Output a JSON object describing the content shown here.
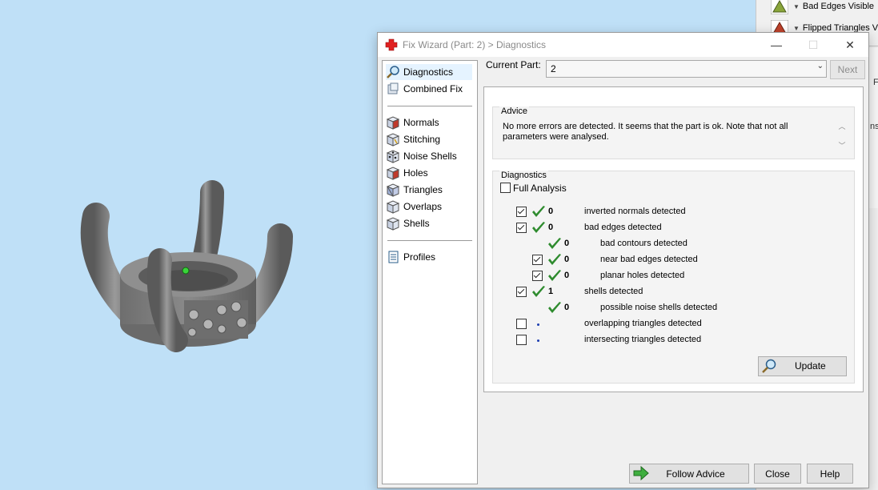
{
  "background_panel": {
    "items": [
      {
        "label": "Bad Edges Visible",
        "icon": "triangle-icon",
        "color": "#8aa53a"
      },
      {
        "label": "Flipped Triangles V",
        "icon": "triangle-icon",
        "color": "#c0432c"
      }
    ],
    "fragments": [
      "ns",
      "F"
    ]
  },
  "dialog": {
    "title": "Fix Wizard (Part: 2) > Diagnostics",
    "app_icon": "red-cross-icon",
    "window_buttons": {
      "minimize": "—",
      "maximize": "☐",
      "close": "✕"
    },
    "nav": {
      "items_top": [
        {
          "label": "Diagnostics",
          "icon": "magnifier-icon",
          "selected": true
        },
        {
          "label": "Combined Fix",
          "icon": "combined-fix-icon",
          "selected": false
        }
      ],
      "items_mid": [
        {
          "label": "Normals",
          "icon": "normals-cube-icon"
        },
        {
          "label": "Stitching",
          "icon": "stitching-cube-icon"
        },
        {
          "label": "Noise Shells",
          "icon": "noise-shells-cube-icon"
        },
        {
          "label": "Holes",
          "icon": "holes-cube-icon"
        },
        {
          "label": "Triangles",
          "icon": "triangles-cube-icon"
        },
        {
          "label": "Overlaps",
          "icon": "overlaps-cube-icon"
        },
        {
          "label": "Shells",
          "icon": "shells-cube-icon"
        }
      ],
      "items_bottom": [
        {
          "label": "Profiles",
          "icon": "document-icon"
        }
      ]
    },
    "current_part_label": "Current Part:",
    "current_part_value": "2",
    "next_label": "Next",
    "advice": {
      "title": "Advice",
      "text": "No more errors are detected. It seems that the part is ok. Note that not all parameters were analysed."
    },
    "diagnostics": {
      "title": "Diagnostics",
      "full_analysis_label": "Full Analysis",
      "full_analysis_checked": false,
      "rows": [
        {
          "checkbox": true,
          "checked": true,
          "status": "ok",
          "count": "0",
          "label": "inverted normals detected",
          "indent": 0
        },
        {
          "checkbox": true,
          "checked": true,
          "status": "ok",
          "count": "0",
          "label": "bad edges detected",
          "indent": 0
        },
        {
          "checkbox": false,
          "checked": false,
          "status": "ok",
          "count": "0",
          "label": "bad contours detected",
          "indent": 1
        },
        {
          "checkbox": true,
          "checked": true,
          "status": "ok",
          "count": "0",
          "label": "near bad edges detected",
          "indent": 1
        },
        {
          "checkbox": true,
          "checked": true,
          "status": "ok",
          "count": "0",
          "label": "planar holes detected",
          "indent": 1
        },
        {
          "checkbox": true,
          "checked": true,
          "status": "ok",
          "count": "1",
          "label": "shells detected",
          "indent": 0
        },
        {
          "checkbox": false,
          "checked": false,
          "status": "ok",
          "count": "0",
          "label": "possible noise shells detected",
          "indent": 1
        },
        {
          "checkbox": true,
          "checked": false,
          "status": "pending",
          "count": "",
          "label": "overlapping triangles detected",
          "indent": 0
        },
        {
          "checkbox": true,
          "checked": false,
          "status": "pending",
          "count": "",
          "label": "intersecting triangles detected",
          "indent": 0
        }
      ],
      "update_label": "Update"
    },
    "buttons": {
      "follow_advice": "Follow Advice",
      "close": "Close",
      "help": "Help"
    },
    "colors": {
      "check": "#2e8b2e",
      "follow_arrow": "#3fae3f",
      "accent_select": "#e5f3ff"
    }
  }
}
